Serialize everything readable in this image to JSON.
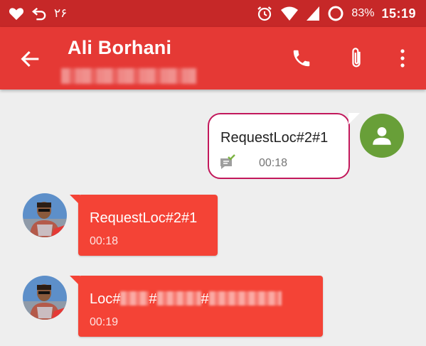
{
  "status_bar": {
    "notification_count": "۲۶",
    "battery_percent": "83%",
    "time": "15:19",
    "icons": [
      "heart-icon",
      "reply-icon",
      "alarm-icon",
      "wifi-icon",
      "signal-icon",
      "battery-ring-icon"
    ]
  },
  "toolbar": {
    "title": "Ali Borhani",
    "icons": [
      "back-arrow-icon",
      "phone-icon",
      "paperclip-icon",
      "more-vert-icon"
    ]
  },
  "colors": {
    "status_bar": "#c62828",
    "toolbar": "#e53935",
    "received_bubble": "#f44336",
    "sent_bubble_border": "#c2185b",
    "my_avatar": "#689f38",
    "background": "#eeeeee"
  },
  "messages": [
    {
      "direction": "sent",
      "text": "RequestLoc#2#1",
      "time": "00:18",
      "status_icon": "delivered-check-icon"
    },
    {
      "direction": "received",
      "text": "RequestLoc#2#1",
      "time": "00:18"
    },
    {
      "direction": "received",
      "text_parts": [
        "Loc#",
        "#",
        "#"
      ],
      "time": "00:19"
    }
  ]
}
